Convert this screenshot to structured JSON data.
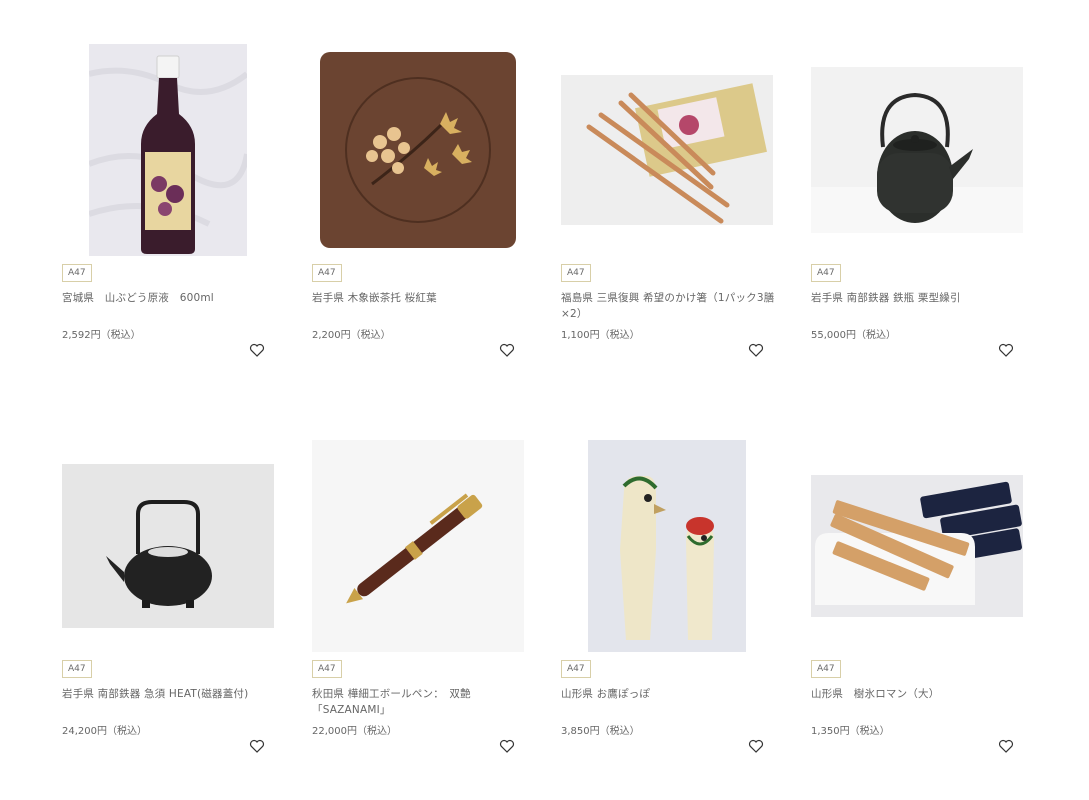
{
  "products": [
    {
      "badge": "A47",
      "title": "宮城県　山ぶどう原液　600ml",
      "price": "2,592円（税込）",
      "icon": "heart-icon"
    },
    {
      "badge": "A47",
      "title": "岩手県 木象嵌茶托 桜紅葉",
      "price": "2,200円（税込）",
      "icon": "heart-icon"
    },
    {
      "badge": "A47",
      "title": "福島県 三県復興 希望のかけ箸（1パック3膳×2）",
      "price": "1,100円（税込）",
      "icon": "heart-icon"
    },
    {
      "badge": "A47",
      "title": "岩手県 南部鉄器 鉄瓶 栗型繰引",
      "price": "55,000円（税込）",
      "icon": "heart-icon"
    },
    {
      "badge": "A47",
      "title": "岩手県 南部鉄器 急須 HEAT(磁器蓋付)",
      "price": "24,200円（税込）",
      "icon": "heart-icon"
    },
    {
      "badge": "A47",
      "title": "秋田県 樺細工ボールペン：　双艶「SAZANAMI」",
      "price": "22,000円（税込）",
      "icon": "heart-icon"
    },
    {
      "badge": "A47",
      "title": "山形県 お鷹ぽっぽ",
      "price": "3,850円（税込）",
      "icon": "heart-icon"
    },
    {
      "badge": "A47",
      "title": "山形県　樹氷ロマン（大）",
      "price": "1,350円（税込）",
      "icon": "heart-icon"
    }
  ]
}
